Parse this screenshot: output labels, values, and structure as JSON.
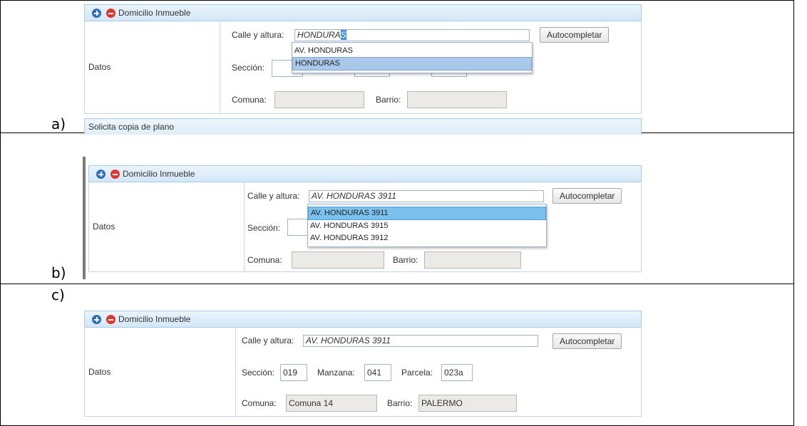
{
  "labels": {
    "a": "a)",
    "b": "b)",
    "c": "c)"
  },
  "section_title": "Domicilio Inmueble",
  "datos_label": "Datos",
  "fields": {
    "calle": "Calle y altura:",
    "seccion": "Sección:",
    "manzana": "Manzana:",
    "parcela": "Parcela:",
    "comuna": "Comuna:",
    "barrio": "Barrio:"
  },
  "autocomplete_label": "Autocompletar",
  "panel_a": {
    "calle_typed": "HONDURA",
    "calle_selected_tail": "S",
    "suggestions": [
      "AV. HONDURAS",
      "HONDURAS"
    ],
    "highlighted_index": 1,
    "next_section": "Solicita copia de plano"
  },
  "panel_b": {
    "calle_value": "AV. HONDURAS 3911",
    "suggestions": [
      "AV. HONDURAS 3911",
      "AV. HONDURAS 3915",
      "AV. HONDURAS 3912"
    ],
    "highlighted_index": 0
  },
  "panel_c": {
    "calle_value": "AV. HONDURAS 3911",
    "seccion": "019",
    "manzana": "041",
    "parcela": "023a",
    "comuna": "Comuna 14",
    "barrio": "PALERMO"
  },
  "icons": [
    "add-icon",
    "remove-icon"
  ],
  "colors": {
    "header": "#d3e7f7",
    "highlight": "#aac8ea",
    "accent_blue": "#2f6fbf",
    "accent_red": "#e0362c"
  }
}
